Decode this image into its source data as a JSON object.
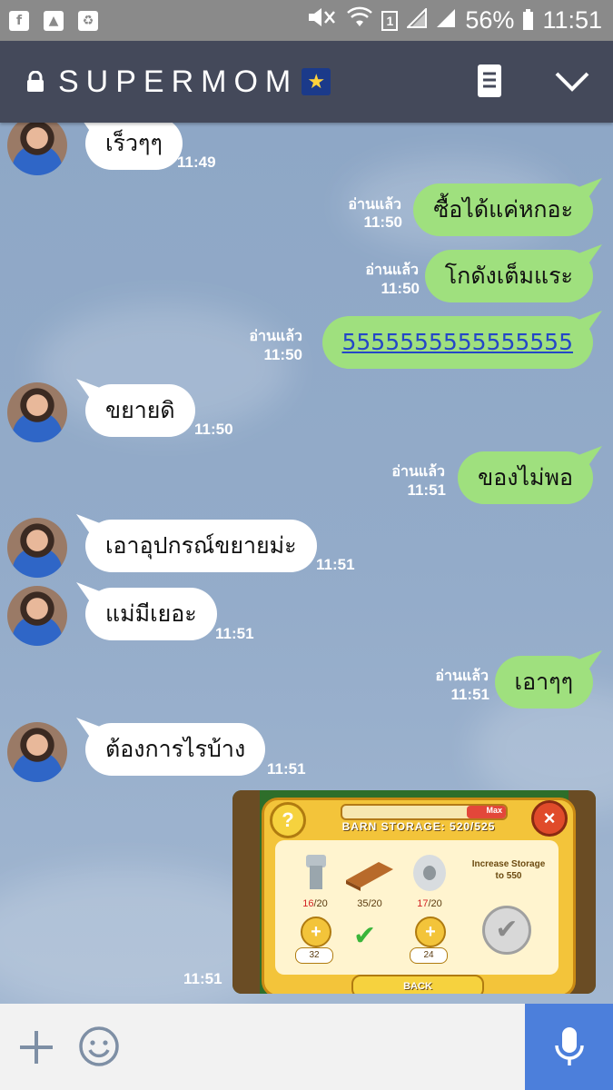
{
  "status_bar": {
    "left_icons": [
      "facebook-icon",
      "gallery-icon",
      "recycle-icon"
    ],
    "sim_slot": "1",
    "battery": "56%",
    "time": "11:51"
  },
  "header": {
    "title": "SUPERMOM",
    "icons": [
      "lock-icon",
      "shooting-star-emoji",
      "notes-icon",
      "chevron-down-icon"
    ]
  },
  "messages": [
    {
      "side": "in",
      "text": "เร็วๆๆ",
      "time": "11:49"
    },
    {
      "side": "out",
      "text": "ซื้อได้แค่หกอะ",
      "read": "อ่านแล้ว",
      "time": "11:50"
    },
    {
      "side": "out",
      "text": "โกดังเต็มแระ",
      "read": "อ่านแล้ว",
      "time": "11:50"
    },
    {
      "side": "out",
      "text": "5555555555555555",
      "read": "อ่านแล้ว",
      "time": "11:50"
    },
    {
      "side": "in",
      "text": "ขยายดิ",
      "time": "11:50"
    },
    {
      "side": "out",
      "text": "ของไม่พอ",
      "read": "อ่านแล้ว",
      "time": "11:51"
    },
    {
      "side": "in",
      "text": "เอาอุปกรณ์ขยายม่ะ",
      "time": "11:51"
    },
    {
      "side": "in",
      "text": "แม่มีเยอะ",
      "time": "11:51"
    },
    {
      "side": "out",
      "text": "เอาๆๆ",
      "read": "อ่านแล้ว",
      "time": "11:51"
    },
    {
      "side": "in",
      "text": "ต้องการไรบ้าง",
      "time": "11:51"
    }
  ],
  "image_message": {
    "time": "11:51",
    "game": {
      "title": "BARN STORAGE: 520/525",
      "max_label": "Max",
      "items": [
        {
          "name": "bolt",
          "have": "16",
          "need": "/20",
          "price": "32"
        },
        {
          "name": "plank",
          "have": "35",
          "need": "/20"
        },
        {
          "name": "duct-tape",
          "have": "17",
          "need": "/20",
          "price": "24"
        }
      ],
      "increase_text": "Increase Storage to 550",
      "back_label": "BACK"
    }
  },
  "input_bar": {
    "icons": [
      "plus-icon",
      "emoji-icon",
      "microphone-icon"
    ]
  }
}
